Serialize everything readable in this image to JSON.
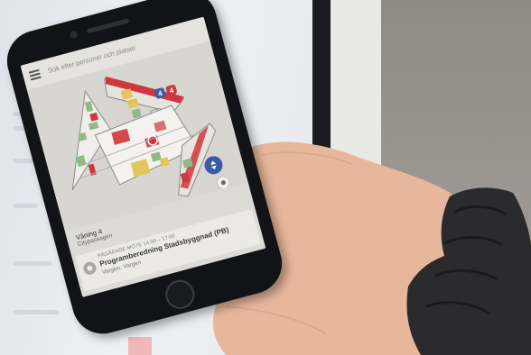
{
  "search": {
    "placeholder": "Sök efter personer och platser"
  },
  "map": {
    "floor": "Våning 4",
    "building": "Citypassagen",
    "badges": [
      {
        "label": "4",
        "color": "#3c5aa8"
      },
      {
        "label": "4",
        "color": "#d0363b"
      }
    ],
    "colors": {
      "accent": "#3c5aa8",
      "highlight": "#d0363b"
    }
  },
  "booking": {
    "time": "PÅGÅENDE MÖTE 14:00 – 17:00",
    "title": "Programberedning Stadsbyggnad (PB)",
    "location": "Vargen, Vargen"
  },
  "icons": [
    "menu-icon",
    "elevator-icon",
    "locate-icon",
    "location-pin-icon"
  ]
}
